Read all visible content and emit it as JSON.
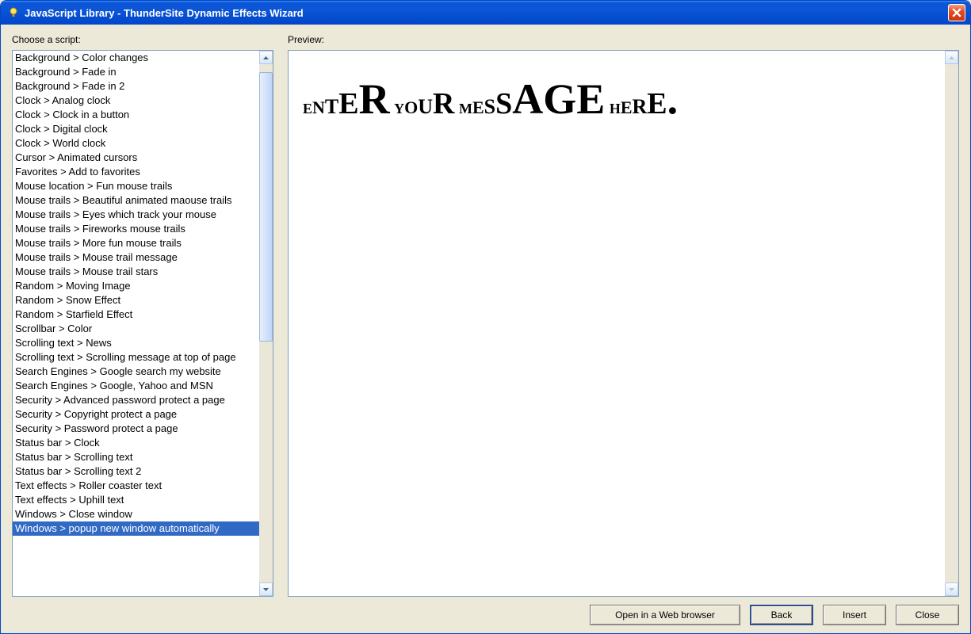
{
  "window_title": "JavaScript Library - ThunderSite Dynamic Effects Wizard",
  "labels": {
    "choose_script": "Choose a script:",
    "preview": "Preview:"
  },
  "preview_message": "ENTER YOUR MESSAGE HERE.",
  "selected_index": 33,
  "script_list": [
    "Background > Color changes",
    "Background > Fade in",
    "Background > Fade in 2",
    "Clock > Analog clock",
    "Clock > Clock in a button",
    "Clock > Digital clock",
    "Clock > World clock",
    "Cursor > Animated cursors",
    "Favorites > Add to favorites",
    "Mouse location > Fun mouse trails",
    "Mouse trails > Beautiful animated maouse trails",
    "Mouse trails > Eyes which track your mouse",
    "Mouse trails > Fireworks mouse trails",
    "Mouse trails > More fun mouse trails",
    "Mouse trails > Mouse trail message",
    "Mouse trails > Mouse trail stars",
    "Random > Moving Image",
    "Random > Snow Effect",
    "Random > Starfield Effect",
    "Scrollbar > Color",
    "Scrolling text > News",
    "Scrolling text > Scrolling message at top of page",
    "Search Engines > Google search my website",
    "Search Engines > Google, Yahoo and MSN",
    "Security > Advanced password protect a page",
    "Security > Copyright protect a page",
    "Security > Password protect a page",
    "Status bar > Clock",
    "Status bar > Scrolling text",
    "Status bar > Scrolling text 2",
    "Text effects > Roller coaster text",
    "Text effects > Uphill text",
    "Windows > Close window",
    "Windows > popup new window automatically"
  ],
  "buttons": {
    "open_browser": "Open in a Web browser",
    "back": "Back",
    "insert": "Insert",
    "close": "Close"
  }
}
